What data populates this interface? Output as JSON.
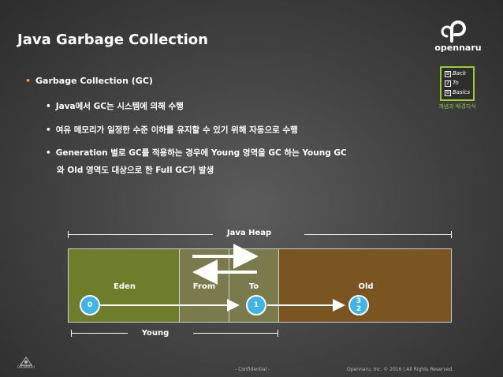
{
  "slide": {
    "title": "Java Garbage Collection"
  },
  "brand": {
    "name": "opennaru",
    "logo_icon": "opennaru-logo-icon"
  },
  "back_to_basics": {
    "lines": [
      "Back",
      "To",
      "Basics"
    ],
    "box_labels": [
      "B",
      "2",
      "B"
    ],
    "caption": "개념과 배경지식",
    "accent_color": "#9acd32"
  },
  "bullets": {
    "level1": "Garbage Collection (GC)",
    "level2": [
      "Java에서 GC는 시스템에 의해 수행",
      "여유 메모리가 일정한 수준 이하를 유지할 수 있기 위해 자동으로 수행",
      "Generation 별로 GC를 적용하는 경우에 Young 영역을 GC 하는 Young GC"
    ],
    "level2_continuation": "와 Old 영역도 대상으로 한 Full GC가 발생",
    "level1_bullet_color": "#f0a030"
  },
  "diagram": {
    "heap_label": "Java Heap",
    "young_label": "Young",
    "segments": {
      "eden": "Eden",
      "from": "From",
      "to": "To",
      "old": "Old"
    },
    "colors": {
      "eden": "#6e7d2c",
      "survivor": "#7a7a4c",
      "old": "#7a5522",
      "object": "#3fb4e6"
    },
    "objects": {
      "eden_age": "0",
      "to_age": "1",
      "old_age_line1": "3",
      "old_age_line2": "2"
    }
  },
  "footer": {
    "confidential": "- Confidential -",
    "copyright": "Opennaru, Inc. © 2016 | All Rights Reserved.",
    "corner_logo_text": "OPENNARU"
  }
}
